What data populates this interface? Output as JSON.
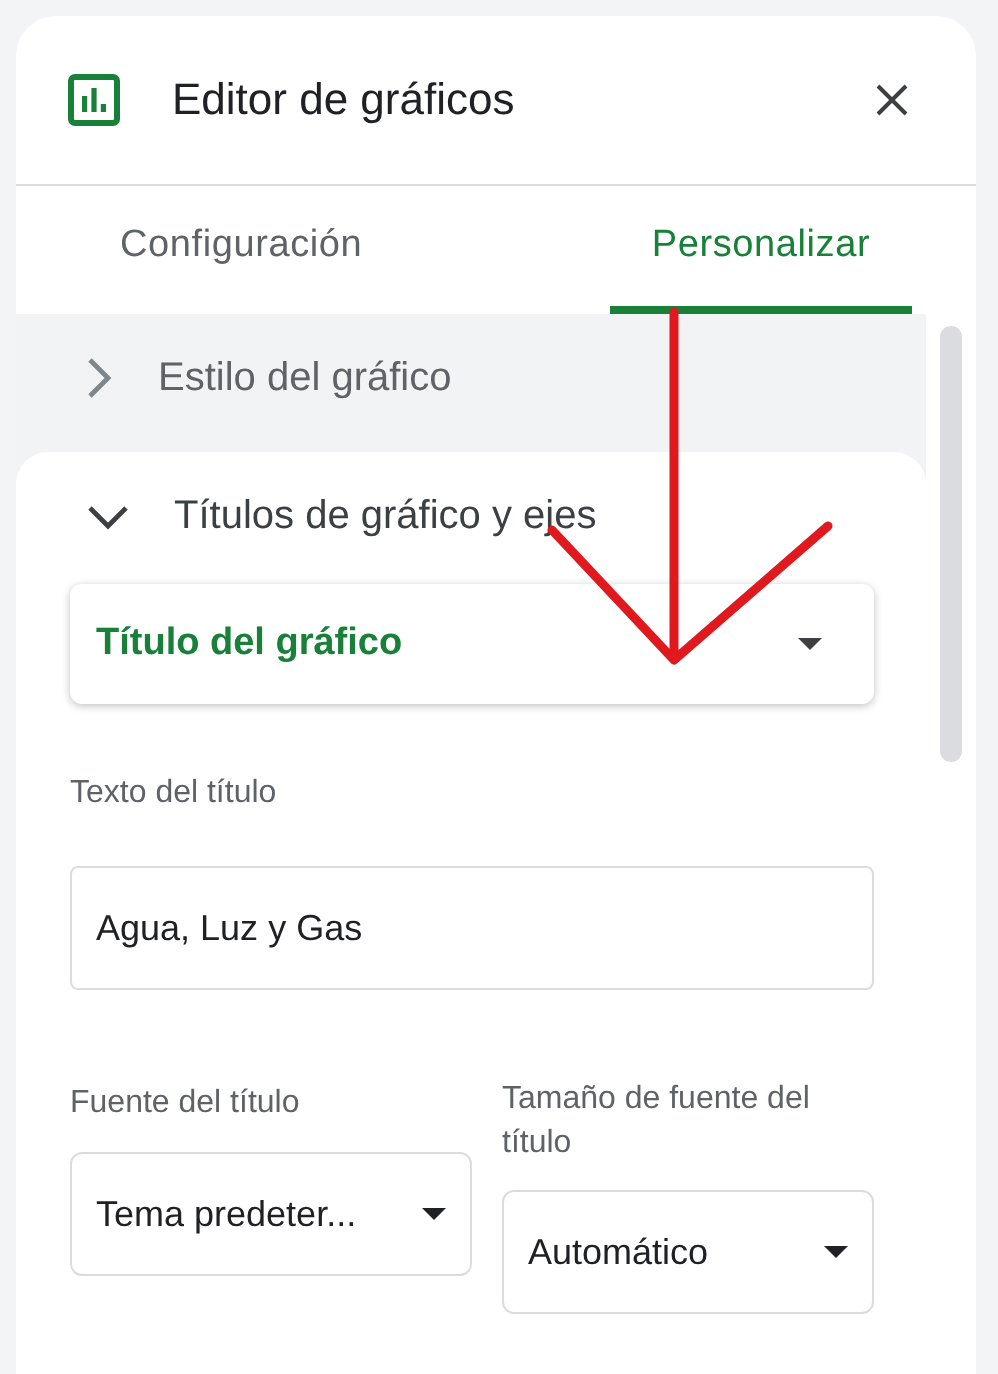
{
  "panel": {
    "title": "Editor de gráficos"
  },
  "tabs": [
    {
      "label": "Configuración",
      "selected": false
    },
    {
      "label": "Personalizar",
      "selected": true
    }
  ],
  "sections": [
    {
      "label": "Estilo del gráfico",
      "expanded": false
    },
    {
      "label": "Títulos de gráfico y ejes",
      "expanded": true
    }
  ],
  "title_selector": {
    "value": "Título del gráfico"
  },
  "title_text": {
    "label": "Texto del título",
    "value": "Agua, Luz y Gas"
  },
  "title_font": {
    "label": "Fuente del título",
    "value": "Tema predeter..."
  },
  "title_font_size": {
    "label": "Tamaño de fuente del título",
    "value": "Automático"
  }
}
